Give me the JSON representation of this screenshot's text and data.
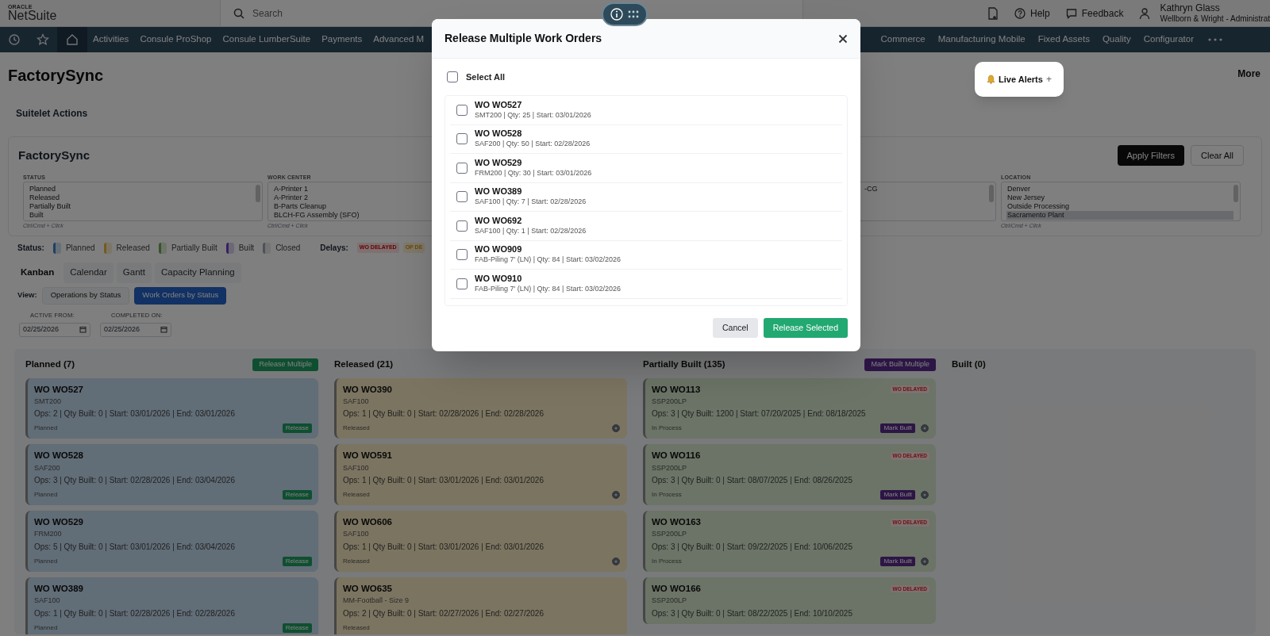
{
  "header": {
    "logo_top": "ORACLE",
    "logo": "NetSuite",
    "search": {
      "placeholder": "Search"
    },
    "links": [
      {
        "label": "Help",
        "kind": "help"
      },
      {
        "label": "Feedback",
        "kind": "feedback"
      }
    ],
    "user": {
      "name": "Kathryn Glass",
      "role": "Wellborn & Wright - Administrat"
    }
  },
  "nav": {
    "left": [
      "Activities",
      "Consule ProShop",
      "Consule LumberSuite",
      "Payments",
      "Advanced M"
    ],
    "right": [
      "Commerce",
      "Manufacturing Mobile",
      "Fixed Assets",
      "Quality",
      "Configurator"
    ]
  },
  "page_title": "FactorySync",
  "suitelet_actions": "Suitelet Actions",
  "more": "More",
  "live_alerts": {
    "label": "Live Alerts",
    "plus": "+"
  },
  "filter_panel": {
    "title": "FactorySync",
    "buttons": [
      {
        "label": "Apply Filters",
        "kind": "primary"
      },
      {
        "label": "Clear All",
        "kind": "secondary"
      }
    ],
    "filters": [
      {
        "label": "STATUS",
        "options": [
          {
            "text": "Planned",
            "selected": false
          },
          {
            "text": "Released",
            "selected": false
          },
          {
            "text": "Partially Built",
            "selected": false
          },
          {
            "text": "Built",
            "selected": false
          }
        ],
        "hint": "Ctrl/Cmd + Click"
      },
      {
        "label": "WORK CENTER",
        "options": [
          {
            "text": "A-Printer 1",
            "selected": false
          },
          {
            "text": "A-Printer 2",
            "selected": false
          },
          {
            "text": "B-Parts Cleanup",
            "selected": false
          },
          {
            "text": "BLCH-FG Assembly (SFO)",
            "selected": false
          }
        ],
        "hint": "Ctrl/Cmd + Click"
      },
      {
        "options": [
          {
            "text": "-CG",
            "selected": false
          }
        ]
      },
      {
        "label": "LOCATION",
        "options": [
          {
            "text": "Denver",
            "selected": false
          },
          {
            "text": "New Jersey",
            "selected": false
          },
          {
            "text": "Outside Processing",
            "selected": false
          },
          {
            "text": "Sacramento Plant",
            "selected": true
          }
        ],
        "hint": "Ctrl/Cmd + Click"
      }
    ]
  },
  "legend": {
    "label": "Status:",
    "items": [
      {
        "label": "Planned",
        "color": "#1e4162"
      },
      {
        "label": "Released",
        "color": "#735c1e"
      },
      {
        "label": "Partially Built",
        "color": "#355428"
      },
      {
        "label": "Built",
        "color": "#362360"
      },
      {
        "label": "Closed",
        "color": "#4e5258"
      }
    ],
    "delays_label": "Delays:",
    "delays": [
      {
        "label": "WO DELAYED",
        "color": "#7e7171"
      },
      {
        "label": "OP DE",
        "color": "#7e786a"
      }
    ]
  },
  "view_tabs": [
    {
      "label": "Kanban",
      "selected": true
    },
    {
      "label": "Calendar",
      "selected": false
    },
    {
      "label": "Gantt",
      "selected": false
    },
    {
      "label": "Capacity Planning",
      "selected": false
    }
  ],
  "view": {
    "label": "View:",
    "options": [
      {
        "label": "Operations by Status",
        "selected": false
      },
      {
        "label": "Work Orders by Status",
        "selected": true
      }
    ]
  },
  "dates": [
    {
      "label": "ACTIVE FROM:",
      "value": "02/25/2026"
    },
    {
      "label": "COMPLETED ON:",
      "value": "02/25/2026"
    }
  ],
  "board": [
    {
      "title": "Planned (7)",
      "color": "#616d77",
      "action": {
        "label": "Release Multiple",
        "kind": "release"
      },
      "cards": [
        {
          "title": "WO WO527",
          "item": "SMT200",
          "details": "Ops: 2 | Qty Built: 0 | Start: 03/01/2026 | End: 03/01/2026",
          "status": "Planned",
          "button": {
            "label": "Release",
            "kind": "release"
          }
        },
        {
          "title": "WO WO528",
          "item": "SAF200",
          "details": "Ops: 3 | Qty Built: 0 | Start: 02/28/2026 | End: 03/04/2026",
          "status": "Planned",
          "button": {
            "label": "Release",
            "kind": "release"
          }
        },
        {
          "title": "WO WO529",
          "item": "FRM200",
          "details": "Ops: 5 | Qty Built: 0 | Start: 03/01/2026 | End: 03/04/2026",
          "status": "Planned",
          "button": {
            "label": "Release",
            "kind": "release"
          }
        },
        {
          "title": "WO WO389",
          "item": "SAF100",
          "details": "Ops: 1 | Qty Built: 0 | Start: 02/28/2026 | End: 02/28/2026",
          "status": "Planned",
          "button": {
            "label": "Release",
            "kind": "release"
          }
        }
      ]
    },
    {
      "title": "Released (21)",
      "color": "#7b7460",
      "cards": [
        {
          "title": "WO WO390",
          "item": "SAF100",
          "details": "Ops: 1 | Qty Built: 0 | Start: 02/28/2026 | End: 02/28/2026",
          "status": "Released",
          "gear": true
        },
        {
          "title": "WO WO591",
          "item": "SAF100",
          "details": "Ops: 1 | Qty Built: 0 | Start: 03/01/2026 | End: 03/01/2026",
          "status": "Released",
          "gear": true
        },
        {
          "title": "WO WO606",
          "item": "SAF100",
          "details": "Ops: 1 | Qty Built: 0 | Start: 03/01/2026 | End: 03/01/2026",
          "status": "Released",
          "gear": true
        },
        {
          "title": "WO WO635",
          "item": "MM-Football - Size 9",
          "details": "Ops: 2 | Qty Built: 0 | Start: 02/27/2026 | End: 02/27/2026",
          "status": "Released"
        }
      ]
    },
    {
      "title": "Partially Built (135)",
      "color": "#6b7466",
      "action": {
        "label": "Mark Built Multiple",
        "kind": "mark_built"
      },
      "cards": [
        {
          "title": "WO WO113",
          "badge": "WO DELAYED",
          "item": "SSP200LP",
          "details": "Ops: 3 | Qty Built: 1200 | Start: 07/20/2025 | End: 08/18/2025",
          "status": "In Process",
          "button": {
            "label": "Mark Built",
            "kind": "mark_built"
          },
          "gear": true
        },
        {
          "title": "WO WO116",
          "badge": "WO DELAYED",
          "item": "SSP200LP",
          "details": "Ops: 3 | Qty Built: 0 | Start: 08/07/2025 | End: 08/26/2025",
          "status": "In Process",
          "button": {
            "label": "Mark Built",
            "kind": "mark_built"
          },
          "gear": true
        },
        {
          "title": "WO WO163",
          "badge": "WO DELAYED",
          "item": "SSP200LP",
          "details": "Ops: 3 | Qty Built: 0 | Start: 09/22/2025 | End: 10/06/2025",
          "status": "In Process",
          "button": {
            "label": "Mark Built",
            "kind": "mark_built"
          },
          "gear": true
        },
        {
          "title": "WO WO166",
          "badge": "WO DELAYED",
          "item": "SSP200LP",
          "details": "Ops: 3 | Qty Built: 0 | Start: 08/22/2025 | End: 10/10/2025"
        }
      ]
    },
    {
      "title": "Built (0)"
    }
  ],
  "modal": {
    "title": "Release Multiple Work Orders",
    "select_all": {
      "label": "Select All",
      "checked": false
    },
    "items": [
      {
        "title": "WO WO527",
        "details": "SMT200 | Qty: 25 | Start: 03/01/2026",
        "checked": false
      },
      {
        "title": "WO WO528",
        "details": "SAF200 | Qty: 50 | Start: 02/28/2026",
        "checked": false
      },
      {
        "title": "WO WO529",
        "details": "FRM200 | Qty: 30 | Start: 03/01/2026",
        "checked": false
      },
      {
        "title": "WO WO389",
        "details": "SAF100 | Qty: 7 | Start: 02/28/2026",
        "checked": false
      },
      {
        "title": "WO WO692",
        "details": "SAF100 | Qty: 1 | Start: 02/28/2026",
        "checked": false
      },
      {
        "title": "WO WO909",
        "details": "FAB-Piling 7' (LN) | Qty: 84 | Start: 03/02/2026",
        "checked": false
      },
      {
        "title": "WO WO910",
        "details": "FAB-Piling 7' (LN) | Qty: 84 | Start: 03/02/2026",
        "checked": false
      }
    ],
    "buttons": [
      {
        "label": "Cancel",
        "kind": "secondary"
      },
      {
        "label": "Release Selected",
        "kind": "primary"
      }
    ]
  }
}
